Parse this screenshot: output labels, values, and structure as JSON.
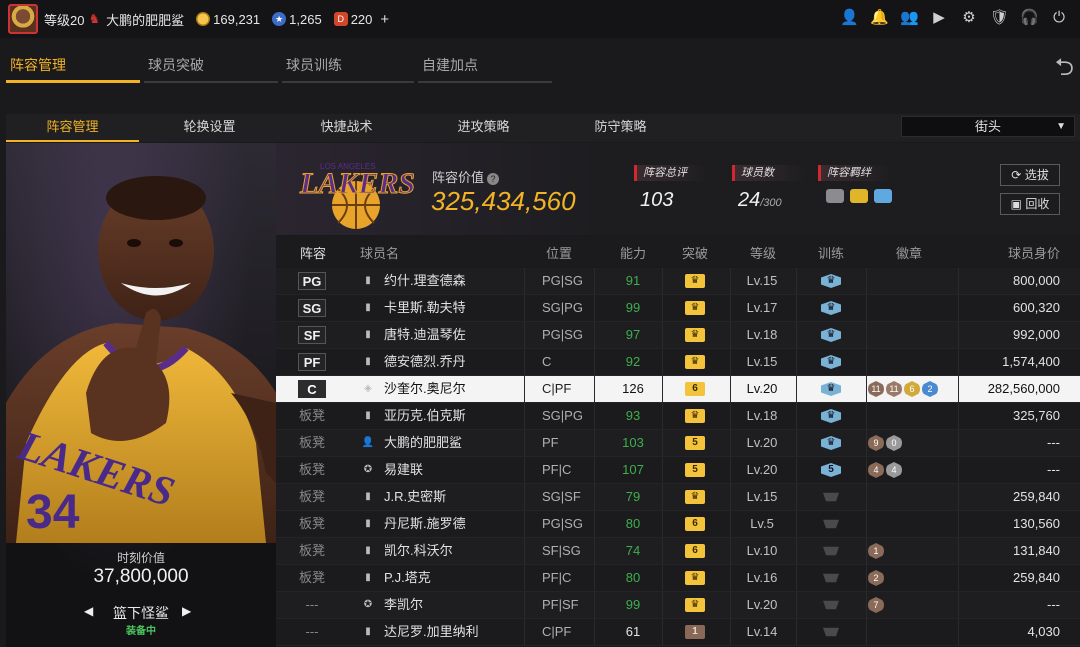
{
  "topbar": {
    "level": "等级20",
    "username": "大鹏的肥肥鲨",
    "gold": "169,231",
    "stars": "1,265",
    "tickets": "220",
    "plus": "+"
  },
  "tabs_main": [
    "阵容管理",
    "球员突破",
    "球员训练",
    "自建加点"
  ],
  "tabs_sub": [
    "阵容管理",
    "轮换设置",
    "快捷战术",
    "进攻策略",
    "防守策略"
  ],
  "dropdown": {
    "value": "街头"
  },
  "portrait": {
    "value_label": "时刻价值",
    "value": "37,800,000",
    "name": "篮下怪鲨",
    "status": "装备中",
    "prev": "◀",
    "next": "▶"
  },
  "summary": {
    "value_label": "阵容价值",
    "value": "325,434,560",
    "rating_label": "阵容总评",
    "rating": "103",
    "count_label": "球员数",
    "count": "24",
    "count_max": "/300",
    "bond_label": "阵容羁绊",
    "btn_select": "选拔",
    "btn_recycle": "回收"
  },
  "columns": {
    "slot": "阵容",
    "name": "球员名",
    "pos": "位置",
    "ability": "能力",
    "breakthrough": "突破",
    "level": "等级",
    "training": "训练",
    "badge": "徽章",
    "worth": "球员身价"
  },
  "colors": {
    "accent": "#f2b325",
    "green": "#3fae4d",
    "red_marker": "#d0282e"
  },
  "rows": [
    {
      "slot": "PG",
      "name": "约什.理查德森",
      "pos": "PG|SG",
      "ability": "91",
      "green": true,
      "brk": "",
      "level": "Lv.15",
      "trn": "",
      "badges": [],
      "worth": "800,000"
    },
    {
      "slot": "SG",
      "name": "卡里斯.勒夫特",
      "pos": "SG|PG",
      "ability": "99",
      "green": true,
      "brk": "",
      "level": "Lv.17",
      "trn": "",
      "badges": [],
      "worth": "600,320"
    },
    {
      "slot": "SF",
      "name": "唐特.迪温琴佐",
      "pos": "PG|SG",
      "ability": "97",
      "green": true,
      "brk": "",
      "level": "Lv.18",
      "trn": "",
      "badges": [],
      "worth": "992,000"
    },
    {
      "slot": "PF",
      "name": "德安德烈.乔丹",
      "pos": "C",
      "ability": "92",
      "green": true,
      "brk": "",
      "level": "Lv.15",
      "trn": "",
      "badges": [],
      "worth": "1,574,400"
    },
    {
      "slot": "C",
      "name": "沙奎尔.奥尼尔",
      "pos": "C|PF",
      "ability": "126",
      "green": false,
      "brk": "6",
      "level": "Lv.20",
      "trn": "",
      "badges": [
        "11",
        "11",
        "6",
        "2"
      ],
      "worth": "282,560,000",
      "selected": true
    },
    {
      "slot": "板凳",
      "name": "亚历克.伯克斯",
      "pos": "SG|PG",
      "ability": "93",
      "green": true,
      "brk": "",
      "level": "Lv.18",
      "trn": "",
      "badges": [],
      "worth": "325,760"
    },
    {
      "slot": "板凳",
      "name": "大鹏的肥肥鲨",
      "pos": "PF",
      "ability": "103",
      "green": true,
      "brk": "5",
      "level": "Lv.20",
      "trn": "",
      "badges": [
        "9",
        "0"
      ],
      "worth": "---"
    },
    {
      "slot": "板凳",
      "name": "易建联",
      "pos": "PF|C",
      "ability": "107",
      "green": true,
      "brk": "5",
      "level": "Lv.20",
      "trn": "5",
      "badges": [
        "4",
        "4"
      ],
      "worth": "---"
    },
    {
      "slot": "板凳",
      "name": "J.R.史密斯",
      "pos": "SG|SF",
      "ability": "79",
      "green": true,
      "brk": "",
      "level": "Lv.15",
      "trn": "grey",
      "badges": [],
      "worth": "259,840"
    },
    {
      "slot": "板凳",
      "name": "丹尼斯.施罗德",
      "pos": "PG|SG",
      "ability": "80",
      "green": true,
      "brk": "6",
      "level": "Lv.5",
      "trn": "grey",
      "badges": [],
      "worth": "130,560"
    },
    {
      "slot": "板凳",
      "name": "凯尔.科沃尔",
      "pos": "SF|SG",
      "ability": "74",
      "green": true,
      "brk": "6",
      "level": "Lv.10",
      "trn": "grey",
      "badges": [
        "1"
      ],
      "worth": "131,840"
    },
    {
      "slot": "板凳",
      "name": "P.J.塔克",
      "pos": "PF|C",
      "ability": "80",
      "green": true,
      "brk": "",
      "level": "Lv.16",
      "trn": "grey",
      "badges": [
        "2"
      ],
      "worth": "259,840"
    },
    {
      "slot": "---",
      "name": "李凯尔",
      "pos": "PF|SF",
      "ability": "99",
      "green": true,
      "brk": "",
      "level": "Lv.20",
      "trn": "grey",
      "badges": [
        "7"
      ],
      "worth": "---"
    },
    {
      "slot": "---",
      "name": "达尼罗.加里纳利",
      "pos": "C|PF",
      "ability": "61",
      "green": false,
      "brk": "1b",
      "level": "Lv.14",
      "trn": "grey",
      "badges": [],
      "worth": "4,030"
    }
  ]
}
